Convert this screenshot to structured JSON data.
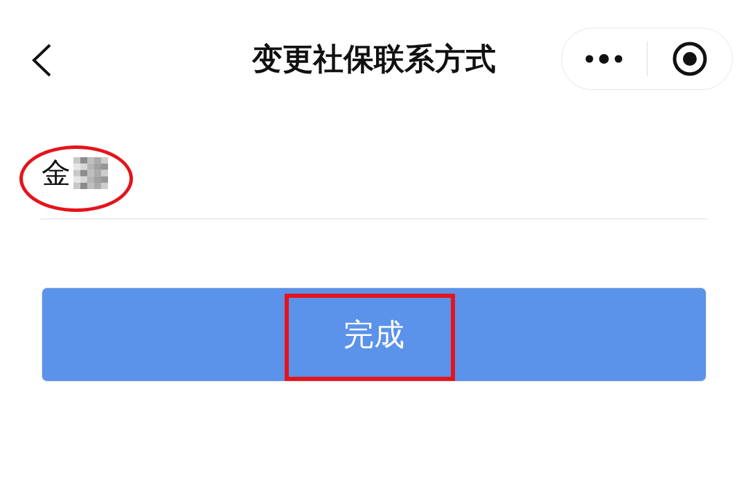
{
  "nav_bar": {
    "title": "变更社保联系方式"
  },
  "name_field": {
    "value": "金",
    "redacted": true,
    "circled": true
  },
  "submit_button": {
    "label": "完成",
    "boxed": true
  }
}
